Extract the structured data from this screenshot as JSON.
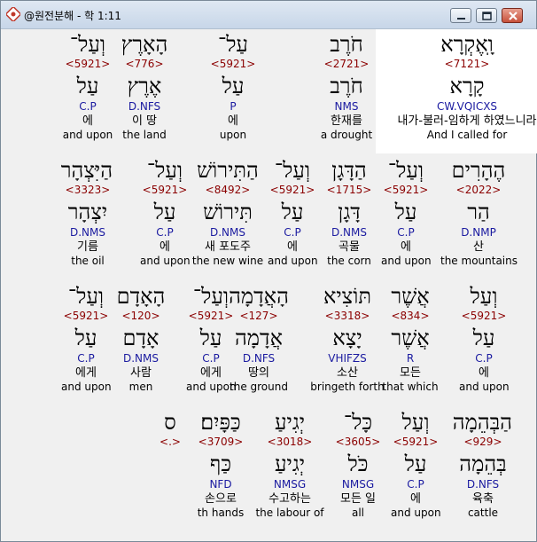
{
  "window": {
    "title": "@원전분해 - 학 1:11"
  },
  "rows": [
    {
      "words": [
        {
          "heb": "וָֽאֶקְרָא",
          "num": "<7121>",
          "root": "קָרָא",
          "code": "CW.VQICXS",
          "kor": "내가-불러-임하게 하였느니라",
          "eng": "And I called for",
          "hl": true
        },
        {
          "heb": "חֹרֶב",
          "num": "<2721>",
          "root": "חֹרֶב",
          "code": "NMS",
          "kor": "한재를",
          "eng": "a drought"
        },
        {
          "heb": "עַל־",
          "num": "<5921>",
          "root": "עַל",
          "code": "P",
          "kor": "에",
          "eng": "upon"
        },
        {
          "heb": "הָאָרֶץ",
          "num": "<776>",
          "root": "אֶרֶץ",
          "code": "D.NFS",
          "kor": "이 땅",
          "eng": "the land"
        },
        {
          "heb": "וְעַל־",
          "num": "<5921>",
          "root": "עַל",
          "code": "C.P",
          "kor": "에",
          "eng": "and upon"
        }
      ]
    },
    {
      "words": [
        {
          "heb": "הֶהָרִים",
          "num": "<2022>",
          "root": "הַר",
          "code": "D.NMP",
          "kor": "산",
          "eng": "the mountains"
        },
        {
          "heb": "וְעַל־",
          "num": "<5921>",
          "root": "עַל",
          "code": "C.P",
          "kor": "에",
          "eng": "and upon"
        },
        {
          "heb": "הַדָּגָן",
          "num": "<1715>",
          "root": "דָּגָן",
          "code": "D.NMS",
          "kor": "곡물",
          "eng": "the corn"
        },
        {
          "heb": "וְעַל־",
          "num": "<5921>",
          "root": "עַל",
          "code": "C.P",
          "kor": "에",
          "eng": "and upon"
        },
        {
          "heb": "הַתִּירוֹשׁ",
          "num": "<8492>",
          "root": "תִּירוֹשׁ",
          "code": "D.NMS",
          "kor": "새 포도주",
          "eng": "the new wine"
        },
        {
          "heb": "וְעַל־",
          "num": "<5921>",
          "root": "עַל",
          "code": "C.P",
          "kor": "에",
          "eng": "and upon"
        },
        {
          "heb": "הַיִּצְהָר",
          "num": "<3323>",
          "root": "יִצְהָר",
          "code": "D.NMS",
          "kor": "기름",
          "eng": "the oil"
        }
      ]
    },
    {
      "words": [
        {
          "heb": "וְעַל",
          "num": "<5921>",
          "root": "עַל",
          "code": "C.P",
          "kor": "에",
          "eng": "and upon"
        },
        {
          "heb": "אֲשֶׁר",
          "num": "<834>",
          "root": "אֲשֶׁר",
          "code": "R",
          "kor": "모든",
          "eng": "that which"
        },
        {
          "heb": "תּוֹצִיא",
          "num": "<3318>",
          "root": "יָצָא",
          "code": "VHIFZS",
          "kor": "소산",
          "eng": "bringeth forth"
        },
        {
          "heb": "הָאֲדָמָה",
          "num": "<127>",
          "root": "אֲדָמָה",
          "code": "D.NFS",
          "kor": "땅의",
          "eng": "the ground"
        },
        {
          "heb": "וְעַל־",
          "num": "<5921>",
          "root": "עַל",
          "code": "C.P",
          "kor": "에게",
          "eng": "and upon"
        },
        {
          "heb": "הָאָדָם",
          "num": "<120>",
          "root": "אָדָם",
          "code": "D.NMS",
          "kor": "사람",
          "eng": "men"
        },
        {
          "heb": "וְעַל־",
          "num": "<5921>",
          "root": "עַל",
          "code": "C.P",
          "kor": "에게",
          "eng": "and upon"
        }
      ]
    },
    {
      "words": [
        {
          "heb": "הַבְּהֵמָה",
          "num": "<929>",
          "root": "בְּהֵמָה",
          "code": "D.NFS",
          "kor": "육축",
          "eng": "cattle"
        },
        {
          "heb": "וְעַל",
          "num": "<5921>",
          "root": "עַל",
          "code": "C.P",
          "kor": "에",
          "eng": "and upon"
        },
        {
          "heb": "כָּל־",
          "num": "<3605>",
          "root": "כֹּל",
          "code": "NMSG",
          "kor": "모든 일",
          "eng": "all"
        },
        {
          "heb": "יְגִיעַ",
          "num": "<3018>",
          "root": "יְגִיעַ",
          "code": "NMSG",
          "kor": "수고하는",
          "eng": "the labour of"
        },
        {
          "heb": "כַּפָּיִם׃",
          "num": "<3709>",
          "root": "כַּף",
          "code": "NFD",
          "kor": "손으로",
          "eng": "th hands"
        },
        {
          "heb": "ס",
          "num": "<.>",
          "root": "",
          "code": "",
          "kor": "",
          "eng": ""
        }
      ]
    }
  ]
}
